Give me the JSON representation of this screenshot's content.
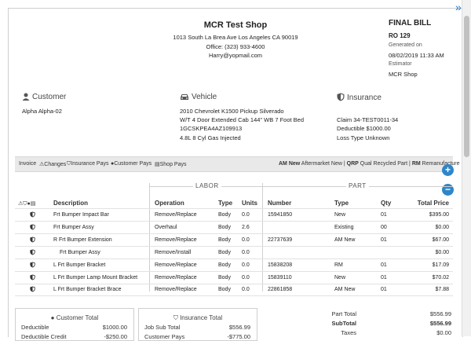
{
  "header": {
    "shop_name": "MCR Test Shop",
    "address": "1013 South La Brea Ave Los Angeles CA 90019",
    "office": "Office: (323) 933-4600",
    "email": "Harry@yopmail.com",
    "bill_title": "FINAL BILL",
    "ro": "RO 129",
    "generated_label": "Generated on",
    "generated_value": "08/02/2019 11:33 AM",
    "estimator_label": "Estimator",
    "estimator_value": "MCR Shop"
  },
  "customer": {
    "title": "Customer",
    "name": "Alpha Alpha-02"
  },
  "vehicle": {
    "title": "Vehicle",
    "lines": [
      "2010 Chevrolet K1500 Pickup Silverado",
      "W/T 4 Door Extended Cab 144\" WB 7 Foot Bed",
      "1GCSKPEA4AZ109913",
      "4.8L 8 Cyl Gas Injected"
    ]
  },
  "insurance": {
    "title": "Insurance",
    "lines": [
      "Claim 34-TEST0011-34",
      "Deductible $1000.00",
      "Loss Type Unknown"
    ]
  },
  "legend": {
    "invoice": "Invoice",
    "changes": "Changes",
    "insurance_pays": "Insurance Pays",
    "customer_pays": "Customer Pays",
    "shop_pays": "Shop Pays",
    "am_code": "AM New",
    "am_text": "Aftermarket New",
    "qrp_code": "QRP",
    "qrp_text": "Qual Recycled Part",
    "rm_code": "RM",
    "rm_text": "Remanufacture",
    "sep": "|"
  },
  "table": {
    "labor_group": "LABOR",
    "part_group": "PART",
    "headers": {
      "description": "Description",
      "operation": "Operation",
      "type": "Type",
      "units": "Units",
      "number": "Number",
      "part_type": "Type",
      "qty": "Qty",
      "total_price": "Total Price"
    },
    "rows": [
      {
        "desc": "Frt Bumper Impact Bar",
        "op": "Remove/Replace",
        "type": "Body",
        "units": "0.0",
        "number": "15941850",
        "ptype": "New",
        "qty": "01",
        "price": "$395.00"
      },
      {
        "desc": "Frt Bumper Assy",
        "op": "Overhaul",
        "type": "Body",
        "units": "2.6",
        "number": "",
        "ptype": "Existing",
        "qty": "00",
        "price": "$0.00"
      },
      {
        "desc": "R Frt Bumper Extension",
        "op": "Remove/Replace",
        "type": "Body",
        "units": "0.0",
        "number": "22737639",
        "ptype": "AM New",
        "qty": "01",
        "price": "$67.00"
      },
      {
        "desc": "Frt Bumper Assy",
        "op": "Remove/Install",
        "type": "Body",
        "units": "0.0",
        "number": "",
        "ptype": "",
        "qty": "",
        "price": "$0.00"
      },
      {
        "desc": "L Frt Bumper Bracket",
        "op": "Remove/Replace",
        "type": "Body",
        "units": "0.0",
        "number": "15838208",
        "ptype": "RM",
        "qty": "01",
        "price": "$17.09"
      },
      {
        "desc": "L Frt Bumper Lamp Mount Bracket",
        "op": "Remove/Replace",
        "type": "Body",
        "units": "0.0",
        "number": "15839110",
        "ptype": "New",
        "qty": "01",
        "price": "$70.02"
      },
      {
        "desc": "L Frt Bumper Bracket Brace",
        "op": "Remove/Replace",
        "type": "Body",
        "units": "0.0",
        "number": "22861858",
        "ptype": "AM New",
        "qty": "01",
        "price": "$7.88"
      }
    ]
  },
  "totals": {
    "customer_title": "Customer Total",
    "customer_rows": [
      {
        "label": "Deductible",
        "value": "$1000.00"
      },
      {
        "label": "Deductible Credit",
        "value": "-$250.00"
      }
    ],
    "insurance_title": "Insurance Total",
    "insurance_rows": [
      {
        "label": "Job Sub Total",
        "value": "$556.99"
      },
      {
        "label": "Customer Pays",
        "value": "-$775.00"
      }
    ],
    "summary_rows": [
      {
        "label": "Part Total",
        "value": "$556.99",
        "bold": false
      },
      {
        "label": "SubTotal",
        "value": "$556.99",
        "bold": true
      },
      {
        "label": "Taxes",
        "value": "$0.00",
        "bold": false
      }
    ]
  },
  "colors": {
    "accent": "#2e86c9",
    "legend_bg": "#e9e9e9"
  }
}
